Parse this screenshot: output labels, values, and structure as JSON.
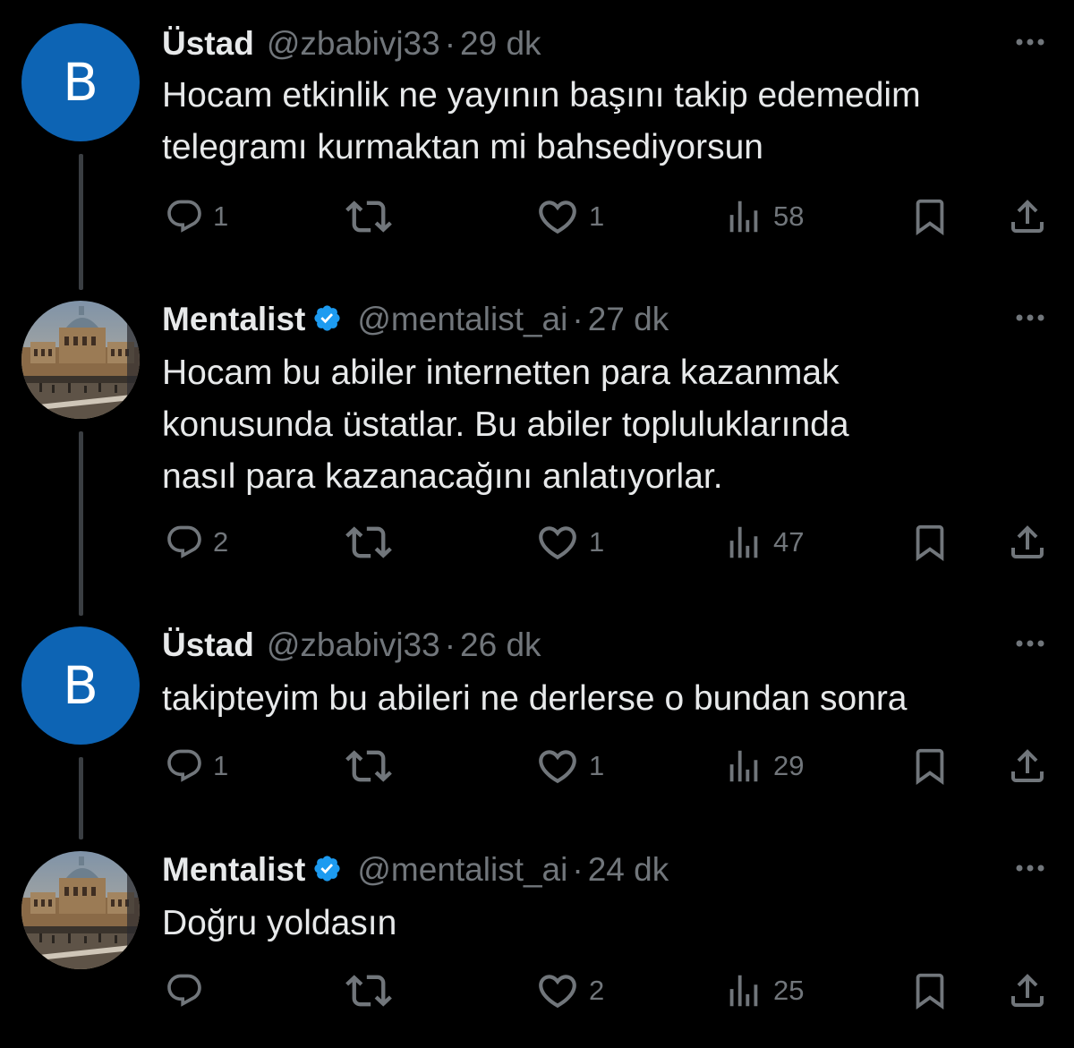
{
  "tweets": [
    {
      "name": "Üstad",
      "handle": "@zbabivj33",
      "separator": "·",
      "time": "29 dk",
      "avatar_letter": "B",
      "text_lines": [
        "Hocam etkinlik ne yayının başını takip edemedim",
        "telegramı kurmaktan mi bahsediyorsun"
      ],
      "replies": "1",
      "reposts": "",
      "likes": "1",
      "views": "58"
    },
    {
      "name": "Mentalist",
      "handle": "@mentalist_ai",
      "separator": "·",
      "time": "27 dk",
      "text_lines": [
        "Hocam bu abiler internetten para kazanmak",
        "konusunda üstatlar. Bu abiler topluluklarında",
        "nasıl para kazanacağını anlatıyorlar."
      ],
      "replies": "2",
      "reposts": "",
      "likes": "1",
      "views": "47"
    },
    {
      "name": "Üstad",
      "handle": "@zbabivj33",
      "separator": "·",
      "time": "26 dk",
      "avatar_letter": "B",
      "text_lines": [
        "takipteyim bu abileri ne derlerse o bundan sonra"
      ],
      "replies": "1",
      "reposts": "",
      "likes": "1",
      "views": "29"
    },
    {
      "name": "Mentalist",
      "handle": "@mentalist_ai",
      "separator": "·",
      "time": "24 dk",
      "text_lines": [
        "Doğru yoldasın"
      ],
      "replies": "",
      "reposts": "",
      "likes": "2",
      "views": "25"
    }
  ],
  "icons": {
    "reply": "reply-icon",
    "repost": "repost-icon",
    "like": "like-icon",
    "views": "views-icon",
    "bookmark": "bookmark-icon",
    "share": "share-icon",
    "more": "more-icon",
    "verified": "verified-badge-icon"
  },
  "colors": {
    "background": "#000000",
    "text": "#e7e9ea",
    "secondary": "#71767b",
    "letter_avatar": "#0d64b4",
    "verified": "#1d9bf0"
  }
}
